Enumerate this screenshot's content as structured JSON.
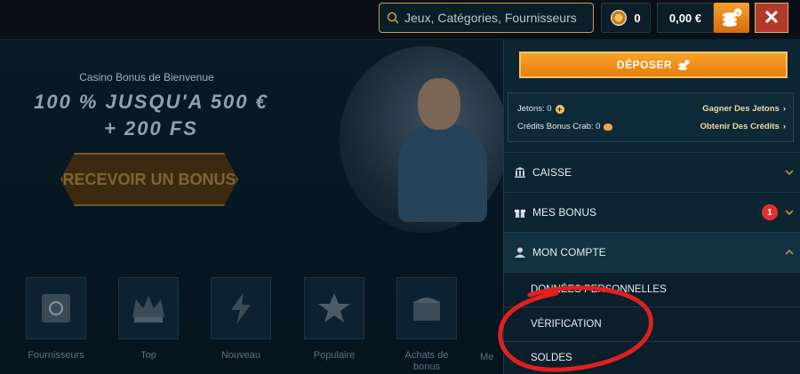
{
  "header": {
    "search_placeholder": "Jeux, Catégories, Fournisseurs",
    "coins_count": "0",
    "balance": "0,00 €"
  },
  "hero": {
    "subtitle": "Casino Bonus de Bienvenue",
    "title_line1": "100 % JUSQU'A 500 €",
    "title_line2": "+ 200 FS",
    "cta_label": "RECEVOIR UN BONUS"
  },
  "categories": [
    {
      "label": "Fournisseurs",
      "icon": "safe-icon"
    },
    {
      "label": "Top",
      "icon": "crown-icon"
    },
    {
      "label": "Nouveau",
      "icon": "lightning-icon"
    },
    {
      "label": "Populaire",
      "icon": "star-icon"
    },
    {
      "label": "Achats de bonus",
      "icon": "chest-icon"
    },
    {
      "label": "Me",
      "icon": "bag-icon"
    }
  ],
  "panel": {
    "deposit_label": "DÉPOSER",
    "jetons_label": "Jetons: 0",
    "gagner_label": "Gagner Des Jetons",
    "credits_label": "Crédits Bonus Crab: 0",
    "obtenir_label": "Obtenir Des Crédits",
    "menu": [
      {
        "label": "CAISSE",
        "icon": "bank-icon"
      },
      {
        "label": "MES BONUS",
        "icon": "gift-icon",
        "badge": "1"
      },
      {
        "label": "MON COMPTE",
        "icon": "user-icon"
      }
    ],
    "submenu": [
      {
        "label": "DONNÉES PERSONNELLES"
      },
      {
        "label": "VÉRIFICATION"
      },
      {
        "label": "SOLDES"
      }
    ]
  },
  "colors": {
    "accent_gold": "#c6a04a",
    "deposit_orange": "#f39a1e",
    "close_red": "#b23a2a",
    "badge_red": "#e03131",
    "annotation_red": "#e02020",
    "panel_bg": "#0c2531"
  }
}
